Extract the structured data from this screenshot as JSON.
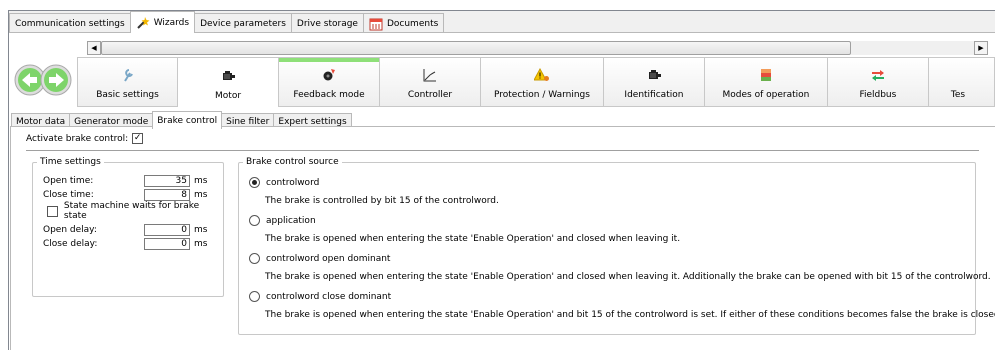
{
  "top_tabs": [
    {
      "label": "Communication settings",
      "icon": null,
      "active": false
    },
    {
      "label": "Wizards",
      "icon": "wand-icon",
      "active": true
    },
    {
      "label": "Device parameters",
      "icon": null,
      "active": false
    },
    {
      "label": "Drive storage",
      "icon": null,
      "active": false
    },
    {
      "label": "Documents",
      "icon": "calendar-icon",
      "active": false
    }
  ],
  "wizard_steps": [
    {
      "label": "Basic settings",
      "icon": "wrench-icon"
    },
    {
      "label": "Motor",
      "icon": "motor-icon"
    },
    {
      "label": "Feedback mode",
      "icon": "feedback-icon"
    },
    {
      "label": "Controller",
      "icon": "controller-curve-icon"
    },
    {
      "label": "Protection / Warnings",
      "icon": "warning-icon"
    },
    {
      "label": "Identification",
      "icon": "motor-icon"
    },
    {
      "label": "Modes of operation",
      "icon": "modes-icon"
    },
    {
      "label": "Fieldbus",
      "icon": "fieldbus-arrows-icon"
    },
    {
      "label": "Tes",
      "icon": null
    }
  ],
  "sub_tabs": [
    "Motor data",
    "Generator mode",
    "Brake control",
    "Sine filter",
    "Expert settings"
  ],
  "activate_brake": {
    "label": "Activate brake control:",
    "checked": true
  },
  "time_settings": {
    "legend": "Time settings",
    "open_time": {
      "label": "Open time:",
      "value": "35",
      "unit": "ms"
    },
    "close_time": {
      "label": "Close time:",
      "value": "8",
      "unit": "ms"
    },
    "state_machine": {
      "label": "State machine waits for brake state",
      "checked": false
    },
    "open_delay": {
      "label": "Open delay:",
      "value": "0",
      "unit": "ms"
    },
    "close_delay": {
      "label": "Close delay:",
      "value": "0",
      "unit": "ms"
    }
  },
  "brake_source": {
    "legend": "Brake control source",
    "options": [
      {
        "label": "controlword",
        "selected": true,
        "desc": "The brake is controlled by bit 15 of the controlword."
      },
      {
        "label": "application",
        "selected": false,
        "desc": "The brake is opened when entering the state 'Enable Operation' and closed when leaving it."
      },
      {
        "label": "controlword open dominant",
        "selected": false,
        "desc": "The brake is opened when entering the state 'Enable Operation' and closed when leaving it. Additionally the brake can be opened with bit 15 of the controlword."
      },
      {
        "label": "controlword close dominant",
        "selected": false,
        "desc": "The brake is opened when entering the state 'Enable Operation' and bit 15 of the controlword is set. If either of these conditions becomes false the brake is closed."
      }
    ]
  }
}
